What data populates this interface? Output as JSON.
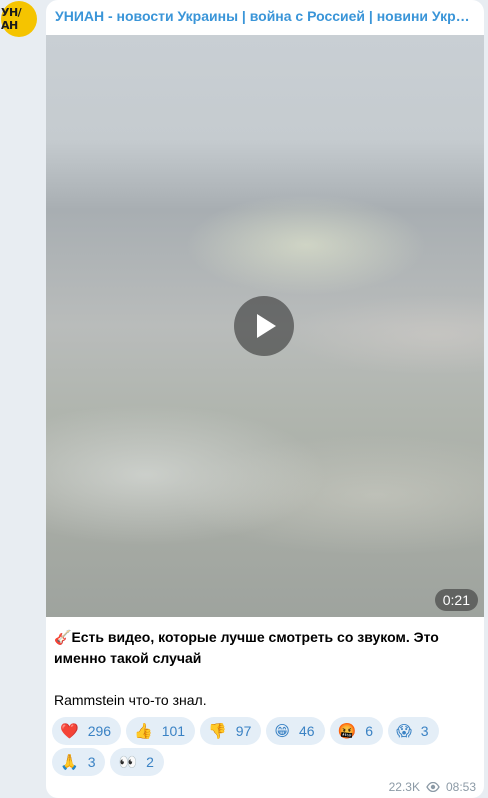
{
  "channel": {
    "avatar_text": "УН/АН",
    "name": "УНИАН - новости Украины | война с Россией | новини України | війна з Росією"
  },
  "video": {
    "duration": "0:21"
  },
  "caption": {
    "emoji": "🎸",
    "bold_text": "Есть видео, которые лучше смотреть со звуком. Это именно такой случай",
    "line2": "Rammstein что-то знал."
  },
  "reactions": [
    {
      "emoji": "❤️",
      "count": "296"
    },
    {
      "emoji": "👍",
      "count": "101"
    },
    {
      "emoji": "👎",
      "count": "97"
    },
    {
      "emoji": "😁",
      "count": "46"
    },
    {
      "emoji": "🤬",
      "count": "6"
    },
    {
      "emoji": "😱",
      "count": "3"
    },
    {
      "emoji": "🙏",
      "count": "3"
    },
    {
      "emoji": "👀",
      "count": "2"
    }
  ],
  "meta": {
    "views": "22.3K",
    "time": "08:53"
  },
  "colors": {
    "accent": "#3a95d8",
    "background": "#e8edf2",
    "reaction_bg": "#e4eef7",
    "avatar_bg": "#f5c400"
  }
}
